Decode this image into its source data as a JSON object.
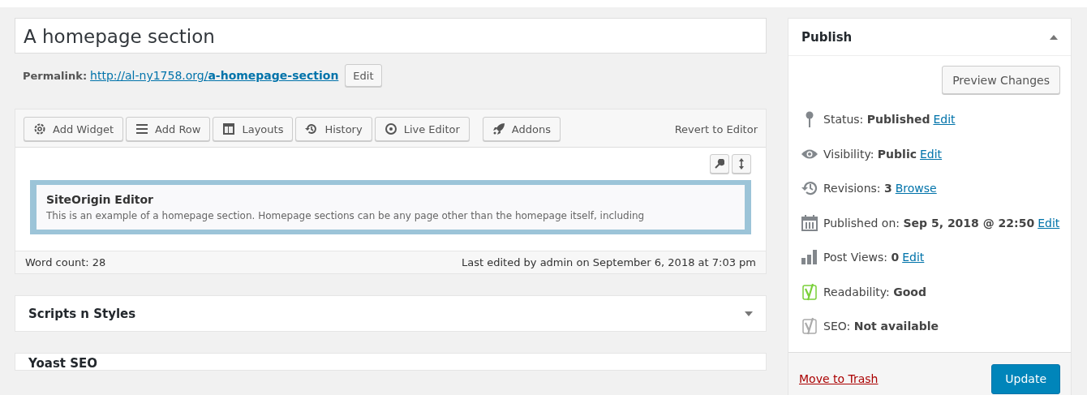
{
  "title_field": {
    "value": "A homepage section"
  },
  "permalink": {
    "label": "Permalink:",
    "url_base": "http://al-ny1758.org/",
    "slug": "a-homepage-section",
    "edit_button": "Edit"
  },
  "builder": {
    "toolbar": [
      {
        "kind": "gear",
        "label": "Add Widget"
      },
      {
        "kind": "rows",
        "label": "Add Row"
      },
      {
        "kind": "layout",
        "label": "Layouts"
      },
      {
        "kind": "history",
        "label": "History"
      },
      {
        "kind": "eye",
        "label": "Live Editor"
      },
      {
        "kind": "rocket",
        "label": "Addons"
      }
    ],
    "revert_link": "Revert to Editor",
    "widget": {
      "title": "SiteOrigin Editor",
      "excerpt": "This is an example of a homepage section. Homepage sections can be any page other than the homepage itself, including"
    },
    "word_count": "Word count: 28",
    "last_edited": "Last edited by admin on September 6, 2018 at 7:03 pm"
  },
  "panels": [
    {
      "title": "Scripts n Styles",
      "expanded": false
    },
    {
      "title": "Yoast SEO"
    }
  ],
  "publish": {
    "title": "Publish",
    "expanded": true,
    "preview_button": "Preview Changes",
    "meta": [
      {
        "kind": "pin",
        "label": "Status:",
        "value": "Published",
        "link": "Edit"
      },
      {
        "kind": "eye",
        "label": "Visibility:",
        "value": "Public",
        "link": "Edit"
      },
      {
        "kind": "history",
        "label": "Revisions:",
        "value": "3",
        "link": "Browse"
      },
      {
        "kind": "calendar",
        "label": "Published on:",
        "value": "Sep 5, 2018 @ 22:50",
        "link": "Edit"
      },
      {
        "kind": "chart",
        "label": "Post Views:",
        "value": "0",
        "link": "Edit"
      },
      {
        "kind": "yoast",
        "color": "#7ad03a",
        "label": "Readability:",
        "value": "Good"
      },
      {
        "kind": "yoast",
        "color": "#aaaaaa",
        "label": "SEO:",
        "value": "Not available"
      }
    ],
    "trash_link": "Move to Trash",
    "update_button": "Update"
  }
}
